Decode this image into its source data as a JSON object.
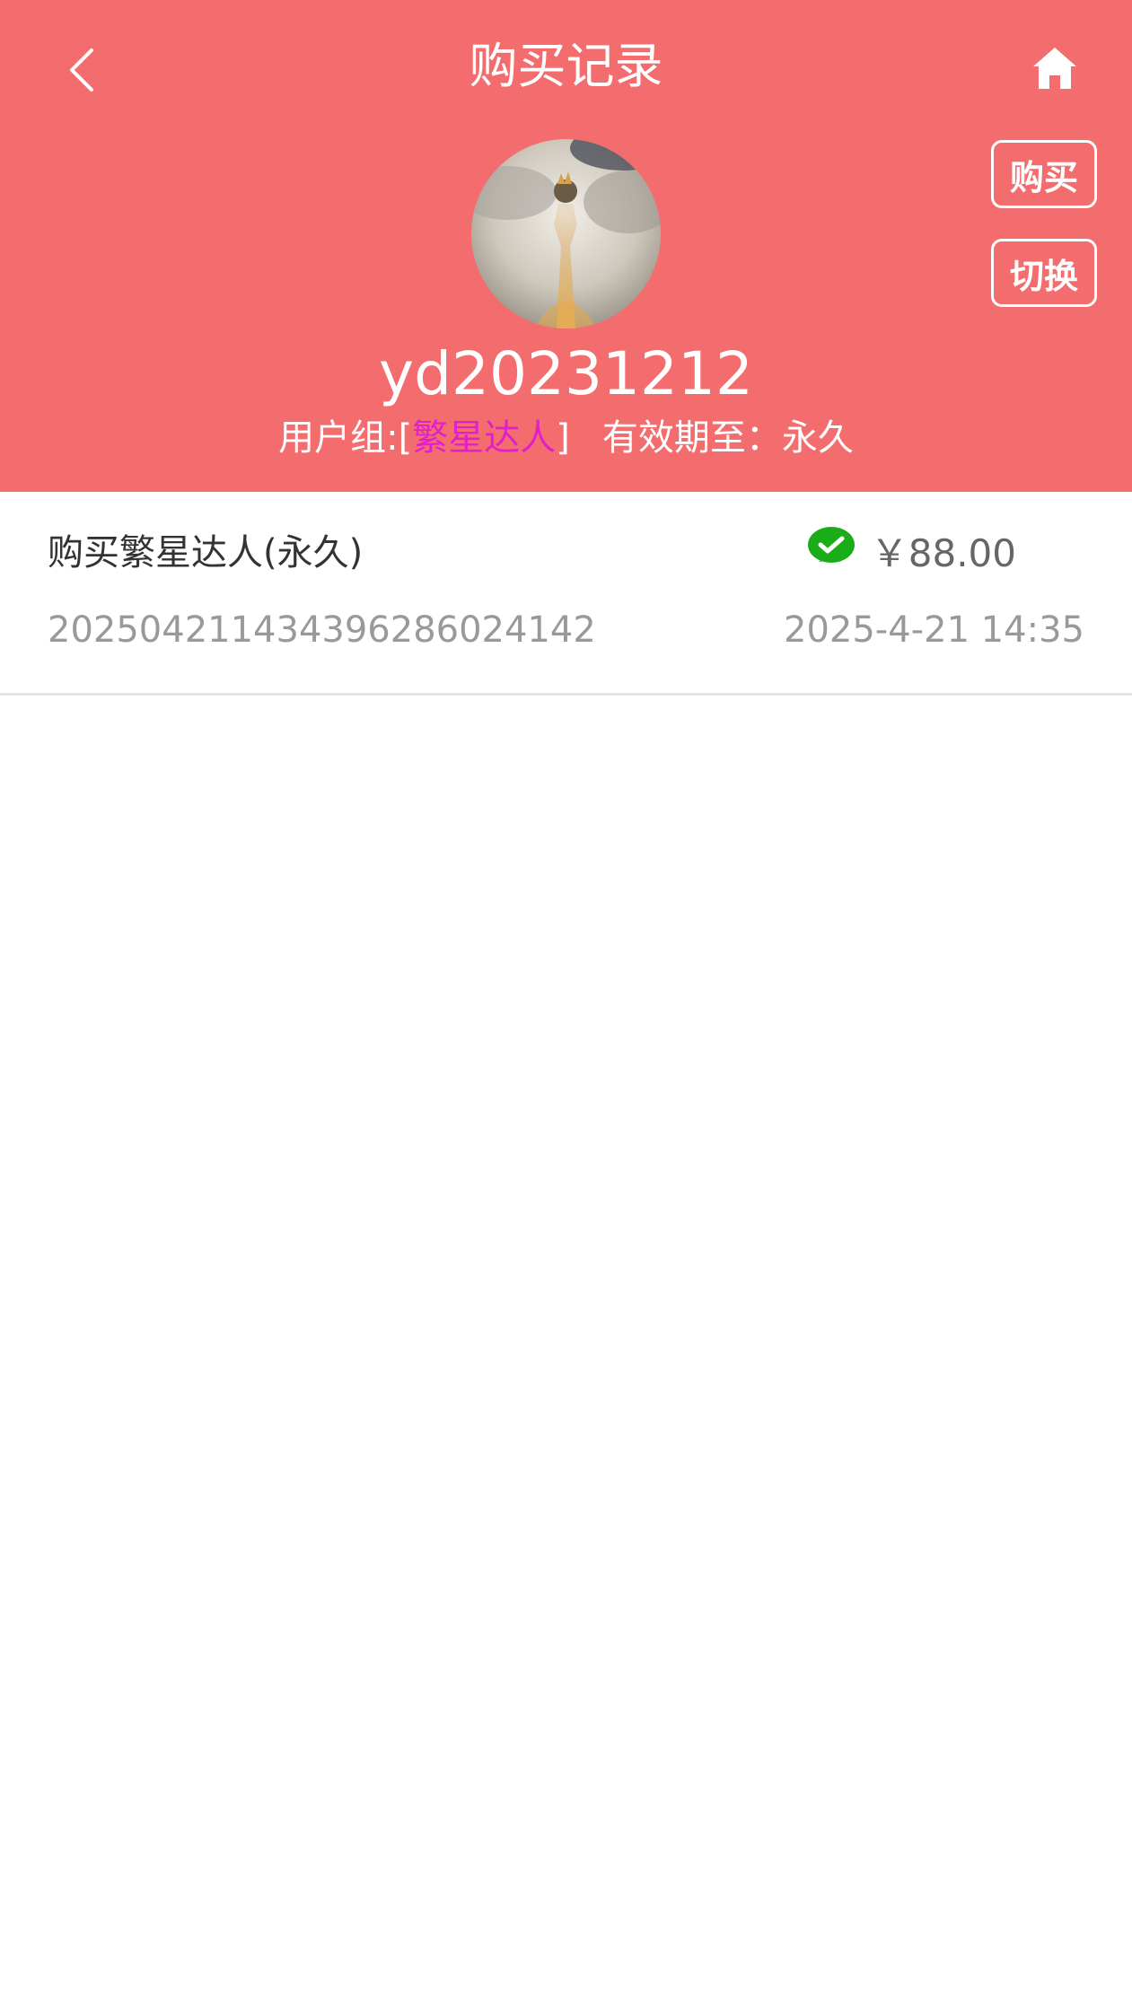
{
  "header": {
    "title": "购买记录",
    "back_icon": "chevron-left-icon",
    "home_icon": "home-icon",
    "buy_label": "购买",
    "switch_label": "切换",
    "background_color": "#f36d6f"
  },
  "profile": {
    "username": "yd20231212",
    "group_label": "用户组:",
    "group_open": "[",
    "group_name": "繁星达人",
    "group_close": "]",
    "expiry_label": "有效期至：",
    "expiry_value": "永久",
    "group_name_color": "#e020c8"
  },
  "records": [
    {
      "title": "购买繁星达人(永久)",
      "payment_icon": "wechat-pay-icon",
      "price": "￥88.00",
      "order_no": "20250421143439628602414​2",
      "time": "2025-4-21 14:35"
    }
  ]
}
